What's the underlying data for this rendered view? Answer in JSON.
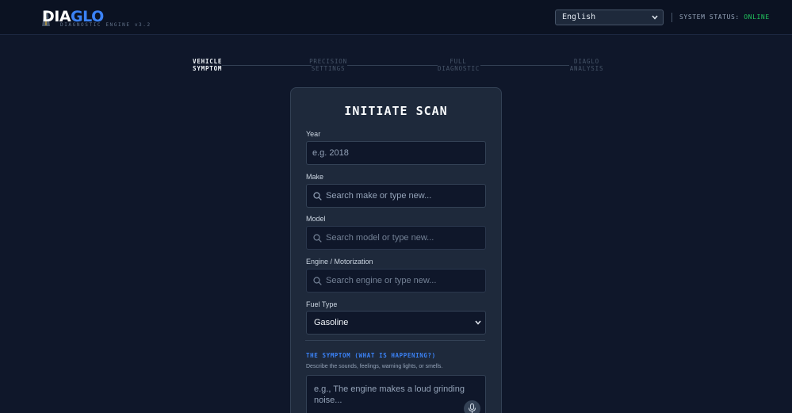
{
  "header": {
    "logo_text_white": "DIA",
    "logo_text_blue": "GLO",
    "logo_subtitle": "DIAGNOSTIC ENGINE v3.2",
    "language_select": {
      "selected": "English"
    },
    "system_status_label": "SYSTEM STATUS:",
    "system_status_value": "ONLINE",
    "system_status_color": "#22c55e"
  },
  "stepper": {
    "steps": [
      {
        "line1": "VEHICLE",
        "line2": "SYMPTOM",
        "active": true
      },
      {
        "line1": "PRECISION",
        "line2": "SETTINGS",
        "active": false
      },
      {
        "line1": "FULL",
        "line2": "DIAGNOSTIC",
        "active": false
      },
      {
        "line1": "DIAGLO",
        "line2": "ANALYSIS",
        "active": false
      }
    ]
  },
  "form": {
    "title": "INITIATE SCAN",
    "year": {
      "label": "Year",
      "placeholder": "e.g. 2018"
    },
    "make": {
      "label": "Make",
      "placeholder": "Search make or type new..."
    },
    "model": {
      "label": "Model",
      "placeholder": "Search model or type new..."
    },
    "engine": {
      "label": "Engine / Motorization",
      "placeholder": "Search engine or type new..."
    },
    "fuel": {
      "label": "Fuel Type",
      "selected": "Gasoline"
    },
    "symptom": {
      "heading": "THE SYMPTOM (WHAT IS HAPPENING?)",
      "description": "Describe the sounds, feelings, warning lights, or smells.",
      "placeholder": "e.g., The engine makes a loud grinding noise..."
    }
  },
  "colors": {
    "background": "#0f172a",
    "card": "#1e293b",
    "accent": "#3b82f6"
  },
  "icons": [
    "road-icon",
    "chevron-down-icon",
    "search-icon",
    "microphone-icon"
  ]
}
